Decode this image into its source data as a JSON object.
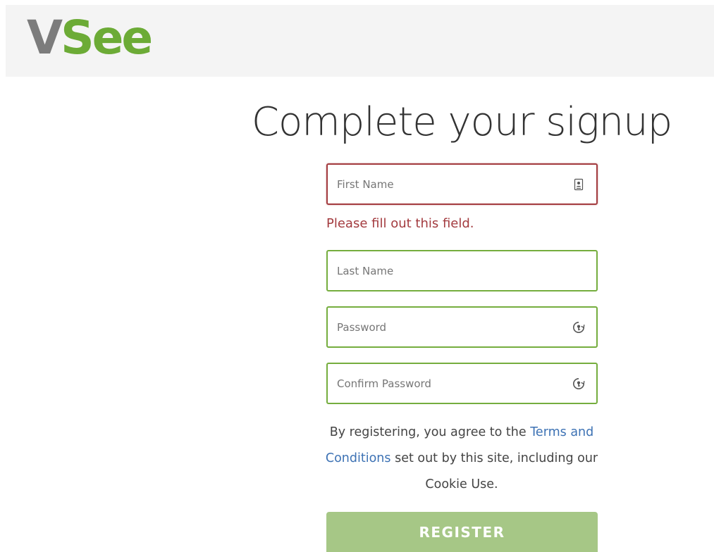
{
  "brand": {
    "logo_v": "V",
    "logo_see": "See",
    "logo_v_color": "#7c7c7c",
    "logo_see_color": "#6cab36"
  },
  "page": {
    "title": "Complete your signup"
  },
  "form": {
    "first_name": {
      "placeholder": "First Name",
      "value": "",
      "icon": "contact-card-icon",
      "state": "invalid",
      "error": "Please fill out this field."
    },
    "last_name": {
      "placeholder": "Last Name",
      "value": ""
    },
    "password": {
      "placeholder": "Password",
      "value": "",
      "icon": "password-manager-icon"
    },
    "confirm_password": {
      "placeholder": "Confirm Password",
      "value": "",
      "icon": "password-manager-icon"
    },
    "terms": {
      "prefix": "By registering, you agree to the ",
      "link": "Terms and Conditions",
      "suffix": " set out by this site, including our Cookie Use."
    },
    "register_label": "REGISTER"
  },
  "colors": {
    "accent_green": "#75ad3e",
    "error_red": "#a33b3f",
    "link_blue": "#3d72b4",
    "button_bg": "#a6c786"
  }
}
